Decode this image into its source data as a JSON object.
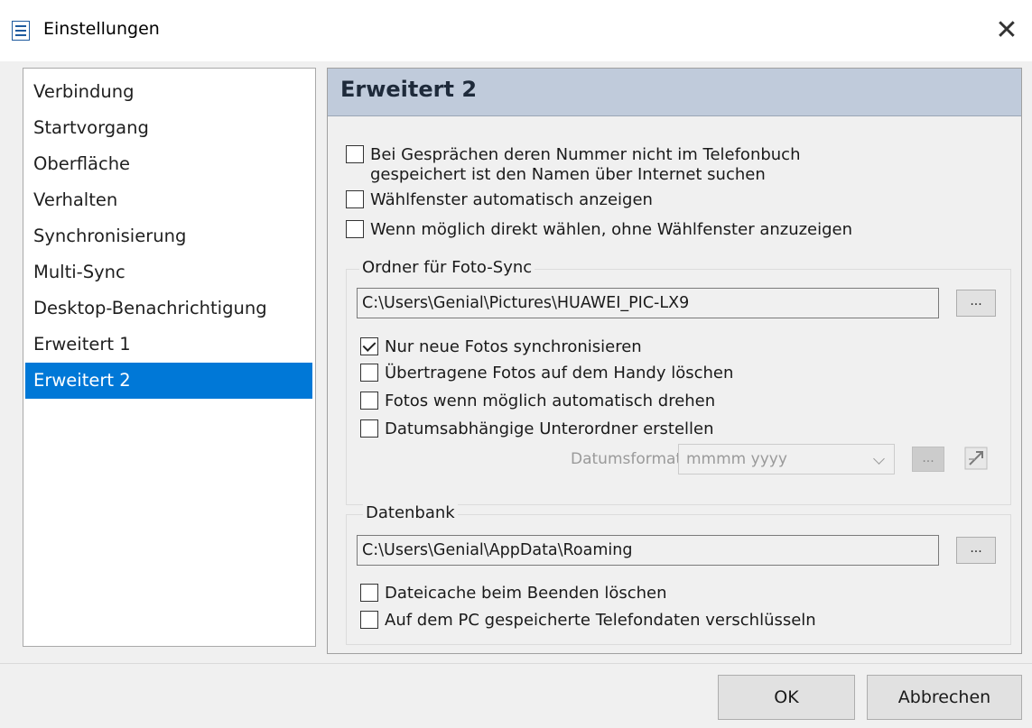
{
  "window": {
    "title": "Einstellungen",
    "close_glyph": "✕"
  },
  "nav": {
    "items": [
      {
        "label": "Verbindung"
      },
      {
        "label": "Startvorgang"
      },
      {
        "label": "Oberfläche"
      },
      {
        "label": "Verhalten"
      },
      {
        "label": "Synchronisierung"
      },
      {
        "label": "Multi-Sync"
      },
      {
        "label": "Desktop-Benachrichtigung"
      },
      {
        "label": "Erweitert 1"
      },
      {
        "label": "Erweitert 2",
        "selected": true
      }
    ]
  },
  "panel": {
    "title": "Erweitert 2",
    "options": [
      {
        "label_line1": "Bei Gesprächen deren Nummer nicht im Telefonbuch",
        "label_line2": "gespeichert ist den Namen über Internet suchen",
        "checked": false
      },
      {
        "label": "Wählfenster automatisch anzeigen",
        "checked": false
      },
      {
        "label": "Wenn möglich direkt wählen, ohne Wählfenster anzuzeigen",
        "checked": false
      }
    ],
    "photo_sync": {
      "title": "Ordner für Foto-Sync",
      "path": "C:\\Users\\Genial\\Pictures\\HUAWEI_PIC-LX9",
      "browse_label": "...",
      "options": [
        {
          "label": "Nur neue Fotos synchronisieren",
          "checked": true
        },
        {
          "label": "Übertragene Fotos auf dem Handy löschen",
          "checked": false
        },
        {
          "label": "Fotos wenn möglich automatisch drehen",
          "checked": false
        },
        {
          "label": "Datumsabhängige Unterordner erstellen",
          "checked": false
        }
      ],
      "date_format_label": "Datumsformat:",
      "date_format_value": "mmmm yyyy",
      "date_browse_label": "..."
    },
    "database": {
      "title": "Datenbank",
      "path": "C:\\Users\\Genial\\AppData\\Roaming",
      "browse_label": "...",
      "options": [
        {
          "label": "Dateicache beim Beenden löschen",
          "checked": false
        },
        {
          "label": "Auf dem PC gespeicherte Telefondaten verschlüsseln",
          "checked": false
        }
      ]
    }
  },
  "buttons": {
    "ok": "OK",
    "cancel": "Abbrechen"
  },
  "colors": {
    "selection": "#0078d7",
    "header": "#c0cbdb"
  }
}
